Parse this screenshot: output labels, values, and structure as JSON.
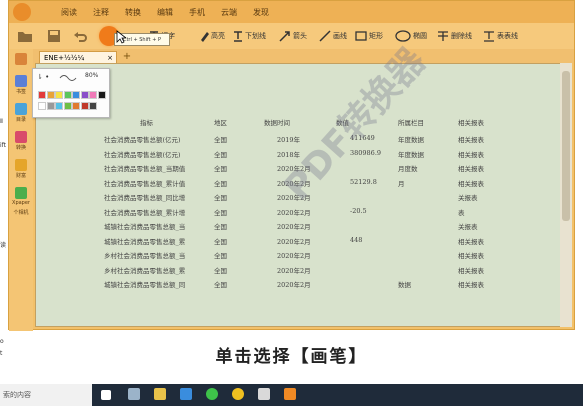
{
  "menu": [
    "阅读",
    "注释",
    "转换",
    "编辑",
    "手机",
    "云端",
    "发现"
  ],
  "tools": [
    {
      "name": "pen-tool",
      "label": ""
    },
    {
      "name": "text-tool",
      "label": "打字"
    },
    {
      "name": "highlight-tool",
      "label": "高亮"
    },
    {
      "name": "underline-tool",
      "label": "下划线"
    },
    {
      "name": "arrow-tool",
      "label": "箭头"
    },
    {
      "name": "line-tool",
      "label": "画线"
    },
    {
      "name": "rect-tool",
      "label": "矩形"
    },
    {
      "name": "ellipse-tool",
      "label": "椭圆"
    },
    {
      "name": "strike-tool",
      "label": "删除线"
    },
    {
      "name": "table-tool",
      "label": "表表线"
    }
  ],
  "tooltip": "Ctrl + Shift + P",
  "tab_label": "ENE+½½¼",
  "sidebar": [
    "书签",
    "目录",
    "转换",
    "财富",
    "Xpaper",
    "个相机"
  ],
  "palette": {
    "zoom": "80%",
    "colors": [
      "#e23b3b",
      "#e8a33a",
      "#f5e247",
      "#5cc65c",
      "#3a8dde",
      "#8a4fc9",
      "#f07ab8",
      "#1a1a1a",
      "#ffffff",
      "#999999",
      "#55c2e6",
      "#6fbe44",
      "#e07a2f",
      "#c0392b",
      "#444444"
    ]
  },
  "table": {
    "headers": [
      "指标",
      "地区",
      "数据时间",
      "数值",
      "所属栏目",
      "相关报表"
    ],
    "rows": [
      [
        "社会消费品零售总额(亿元)",
        "全国",
        "2019年",
        "411649",
        "年度数据",
        "相关报表"
      ],
      [
        "社会消费品零售总额(亿元)",
        "全国",
        "2018年",
        "380986.9",
        "年度数据",
        "相关报表"
      ],
      [
        "社会消费品零售总额_当期值",
        "全国",
        "2020年2月",
        "",
        "月度数",
        "相关报表"
      ],
      [
        "社会消费品零售总额_累计值",
        "全国",
        "2020年2月",
        "52129.8",
        "月",
        "相关报表"
      ],
      [
        "社会消费品零售总额_同比增",
        "全国",
        "2020年2月",
        "",
        "",
        "关报表"
      ],
      [
        "社会消费品零售总额_累计增",
        "全国",
        "2020年2月",
        "-20.5",
        "",
        "表"
      ],
      [
        "城镇社会消费品零售总额_当",
        "全国",
        "2020年2月",
        "",
        "",
        "关报表"
      ],
      [
        "城镇社会消费品零售总额_累",
        "全国",
        "2020年2月",
        "448",
        "",
        "相关报表"
      ],
      [
        "乡村社会消费品零售总额_当",
        "全国",
        "2020年2月",
        "",
        "",
        "相关报表"
      ],
      [
        "乡村社会消费品零售总额_累",
        "全国",
        "2020年2月",
        "",
        "",
        "相关报表"
      ],
      [
        "城镇社会消费品零售总额_同",
        "全国",
        "2020年2月",
        "",
        "数据",
        "相关报表"
      ]
    ]
  },
  "watermark": "PDF转换器",
  "left_strip": [
    "Ⅱ",
    "ift",
    "读",
    "o",
    "t"
  ],
  "subtitle": "单击选择【画笔】",
  "taskbar": {
    "search": "索的内容"
  }
}
